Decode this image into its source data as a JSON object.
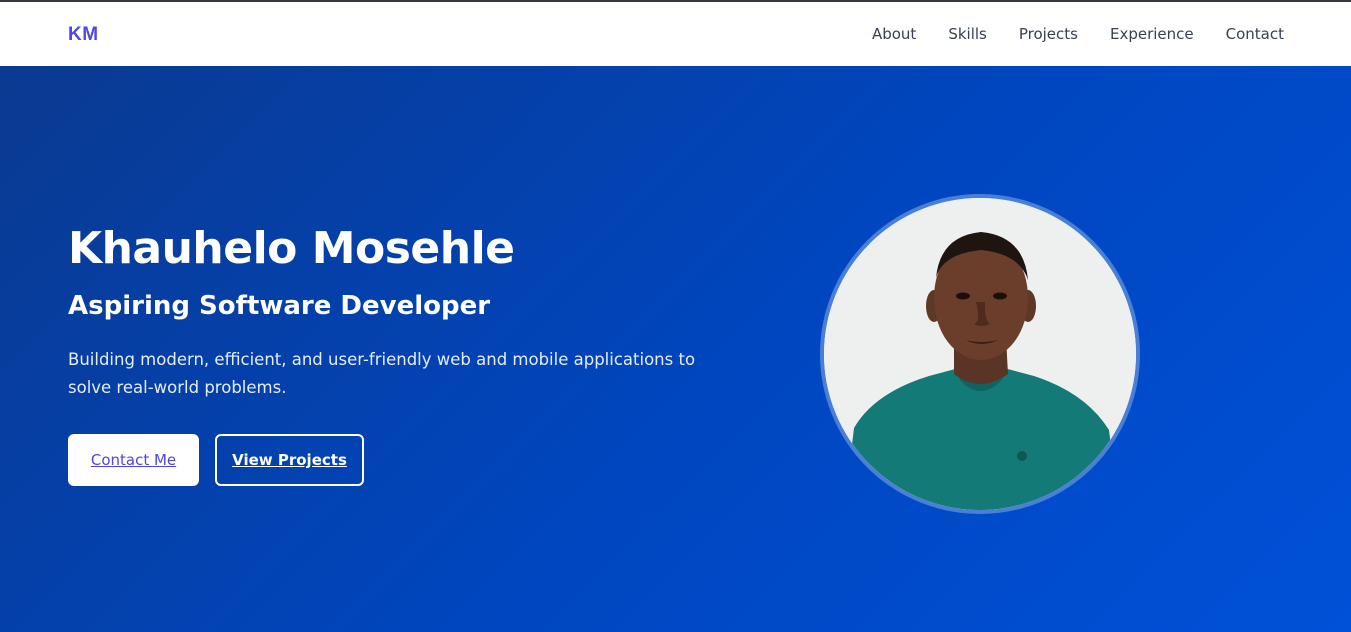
{
  "navbar": {
    "logo": "KM",
    "links": [
      {
        "label": "About"
      },
      {
        "label": "Skills"
      },
      {
        "label": "Projects"
      },
      {
        "label": "Experience"
      },
      {
        "label": "Contact"
      }
    ]
  },
  "hero": {
    "name": "Khauhelo Mosehle",
    "title": "Aspiring Software Developer",
    "description": "Building modern, efficient, and user-friendly web and mobile applications to solve real-world problems.",
    "buttons": {
      "contact": "Contact Me",
      "projects": "View Projects"
    }
  },
  "colors": {
    "accent": "#4f46e5",
    "hero_start": "#0a3a91",
    "hero_end": "#0051d8",
    "avatar_ring": "#4a7fd6"
  }
}
